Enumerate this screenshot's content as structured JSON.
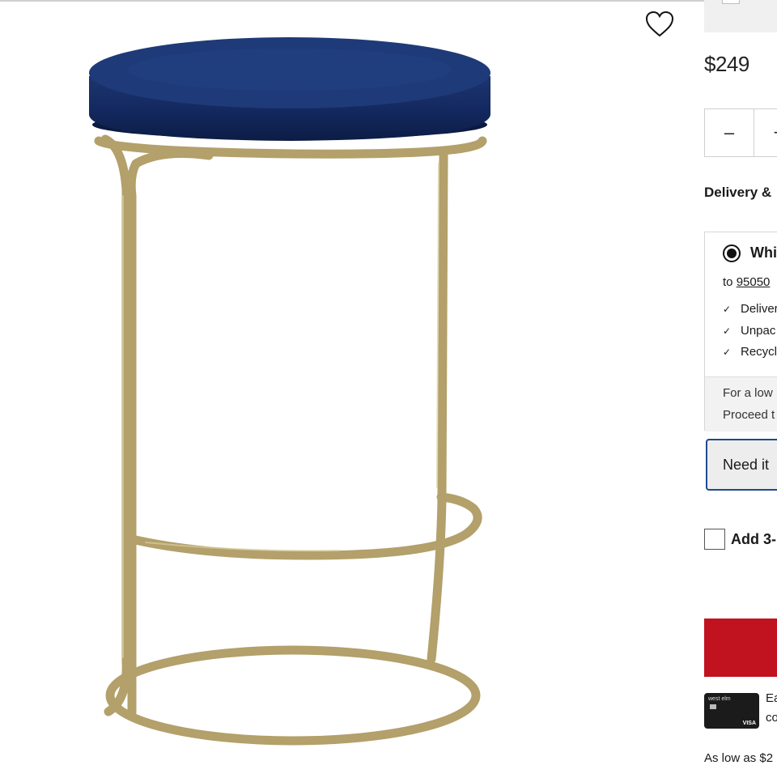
{
  "product": {
    "price": "$249",
    "quantity_minus_label": "–",
    "quantity_plus_label": "+",
    "wishlist_icon": "heart-icon"
  },
  "delivery": {
    "heading": "Delivery &",
    "option_label": "Whi",
    "to_prefix": "to",
    "zip": "95050",
    "features": [
      "Deliver",
      "Unpac",
      "Recycl"
    ],
    "note_line1": "For a low",
    "note_line2": "Proceed t"
  },
  "need_it_label": "Need it",
  "addon_label": "Add 3-",
  "card": {
    "brand": "west elm",
    "network": "VISA",
    "text_line1": "Ea",
    "text_line2": "co"
  },
  "as_low_text": "As low as $2",
  "colors": {
    "accent_blue": "#1d4a8c",
    "cart_red": "#c1121f",
    "velvet_navy": "#13285e",
    "brass_frame": "#b3a06a"
  }
}
